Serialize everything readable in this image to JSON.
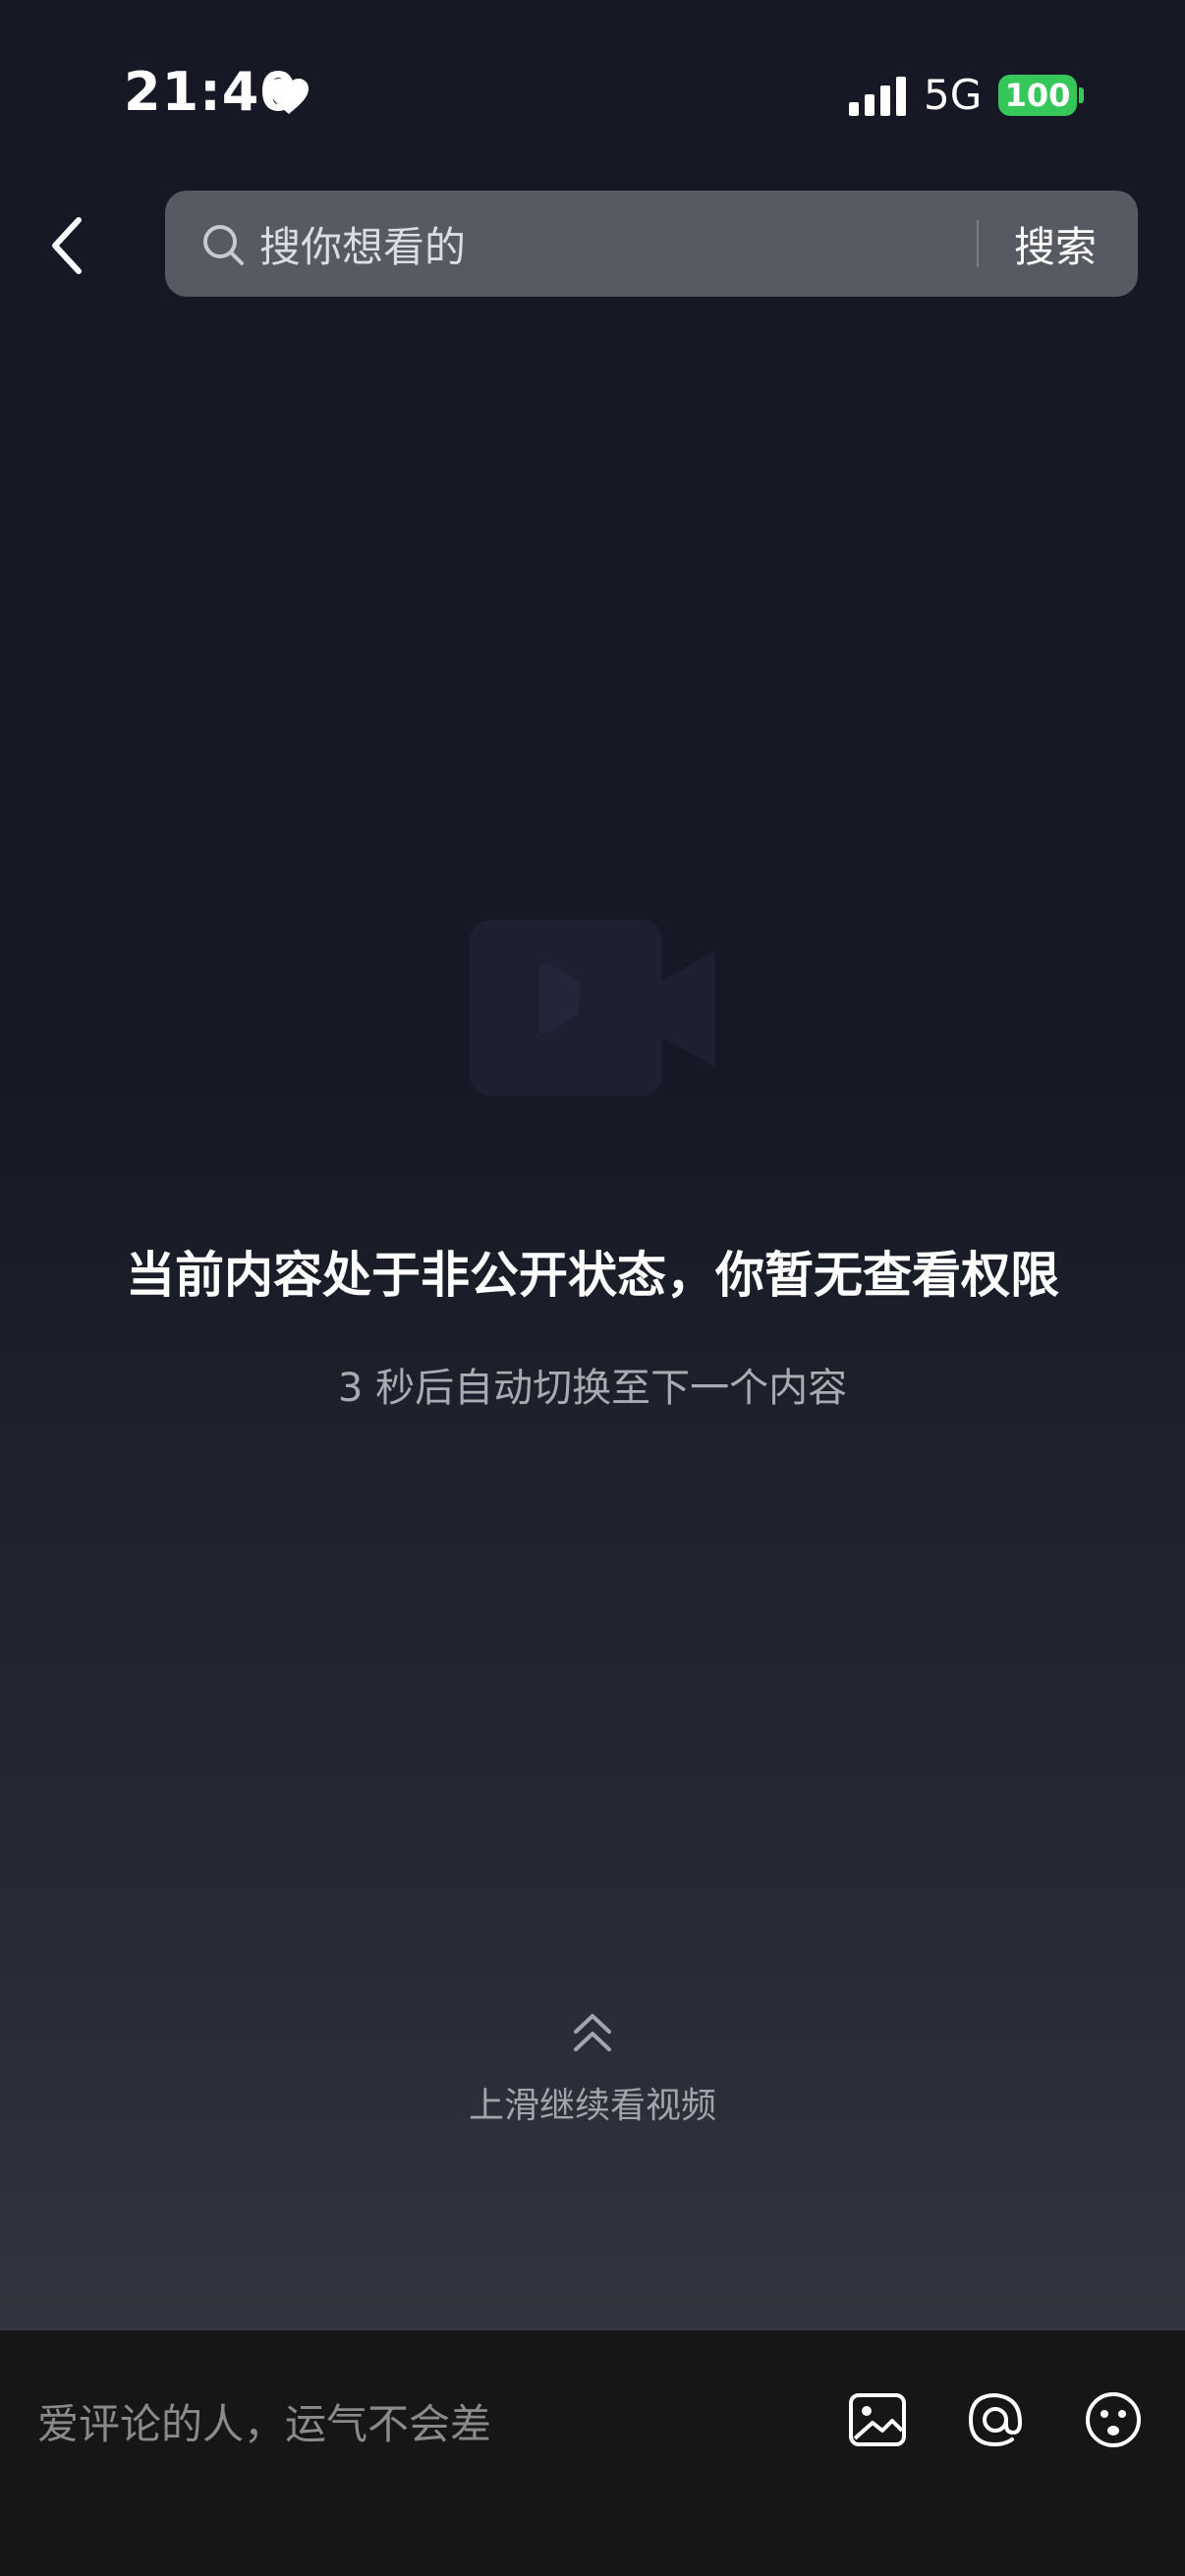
{
  "status_bar": {
    "time": "21:40",
    "network": "5G",
    "battery": "100",
    "icons": [
      "heart-icon",
      "signal-icon",
      "battery-icon"
    ]
  },
  "header": {
    "search_placeholder": "搜你想看的",
    "search_button": "搜索",
    "icons": [
      "back-arrow-icon",
      "search-icon"
    ]
  },
  "main": {
    "message": "当前内容处于非公开状态，你暂无查看权限",
    "sub_message": "3 秒后自动切换至下一个内容",
    "swipe_hint": "上滑继续看视频",
    "icons": [
      "video-placeholder-icon",
      "swipe-up-chevron-icon"
    ]
  },
  "comment_bar": {
    "placeholder": "爱评论的人，运气不会差",
    "icons": [
      "image-icon",
      "at-icon",
      "emoji-icon"
    ]
  },
  "colors": {
    "background_top": "#161925",
    "background_bottom": "#33363f",
    "search_box": "#575a63",
    "battery_green": "#35c759",
    "comment_bar": "#161616"
  }
}
